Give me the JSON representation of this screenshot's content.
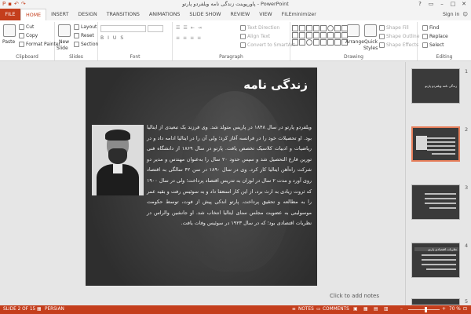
{
  "window": {
    "title": "پاورپوینت زندگی نامه ویلفردو پارتو - PowerPoint",
    "controls": [
      "?",
      "▭",
      "–",
      "□",
      "✕"
    ]
  },
  "tabs": [
    "FILE",
    "HOME",
    "INSERT",
    "DESIGN",
    "TRANSITIONS",
    "ANIMATIONS",
    "SLIDE SHOW",
    "REVIEW",
    "VIEW",
    "FILEminimizer"
  ],
  "active_tab": "HOME",
  "account": {
    "label": "Sign in"
  },
  "ribbon": {
    "clipboard": {
      "label": "Clipboard",
      "paste": "Paste",
      "cut": "Cut",
      "copy": "Copy",
      "format_painter": "Format Painter"
    },
    "slides": {
      "label": "Slides",
      "new_slide": "New",
      "new_slide_2": "Slide",
      "layout": "Layout",
      "reset": "Reset",
      "section": "Section"
    },
    "font": {
      "label": "Font"
    },
    "paragraph": {
      "label": "Paragraph",
      "text_direction": "Text Direction",
      "align_text": "Align Text",
      "convert_smartart": "Convert to SmartArt"
    },
    "drawing": {
      "label": "Drawing",
      "arrange": "Arrange",
      "quick_styles": "Quick",
      "quick_styles_2": "Styles",
      "shape_fill": "Shape Fill",
      "shape_outline": "Shape Outline",
      "shape_effects": "Shape Effects"
    },
    "editing": {
      "label": "Editing",
      "find": "Find",
      "replace": "Replace",
      "select": "Select"
    }
  },
  "slide": {
    "title": "زندگی نامه",
    "body": "ویلفردو پارتو در سال ۱۸۴۸ در پاریس متولد شد. وی فرزند یک تبعیدی از ایتالیا بود. او تحصیلات خود را در فرانسه آغاز کرد؛ ولی آن را در ایتالیا ادامه داد و در ریاضیات و ادبیات کلاسیک تخصص یافت. پارتو در سال ۱۸۶۹ از دانشگاه فنی تورین فارغ التحصیل شد و سپس حدود ۲۰ سال را به‌عنوان مهندس و مدیر دو شرکت راه‌آهن ایتالیا کار کرد. وی در سال ۱۸۹۰ در سن ۴۲ سالگی به اقتصاد روی آورد و مدت ۲ سال در لوزان به تدریس اقتصاد پرداخت؛ ولی در سال ۱۹۰۰ که ثروت زیادی به ارث برد، از این کار استعفا داد و به سوئیس رفت و بقیه عمر را به مطالعه و تحقیق پرداخت. پارتو اندکی پیش از فوت، توسط حکومت موسولینی به عضویت مجلس سنای ایتالیا انتخاب شد. او جانشین والراس در نظریات اقتصادی بود؛ که در سال ۱۹۲۳ در سوئیس وفات یافت."
  },
  "thumbnails": [
    {
      "number": "1",
      "caption": "زندگی نامه ویلفردو پارتو"
    },
    {
      "number": "2"
    },
    {
      "number": "3"
    },
    {
      "number": "4",
      "caption": "نظریات اقتصادی پارتو"
    },
    {
      "number": "5"
    }
  ],
  "notes_placeholder": "Click to add notes",
  "status": {
    "slide_info": "SLIDE 2 OF 15",
    "language": "PERSIAN",
    "notes": "NOTES",
    "comments": "COMMENTS",
    "zoom": "70 %",
    "zoom_level_percent": 70
  },
  "colors": {
    "accent": "#c43e1c",
    "slide_bg": "#3d3d3d",
    "selected_thumb": "#e67e5a"
  }
}
